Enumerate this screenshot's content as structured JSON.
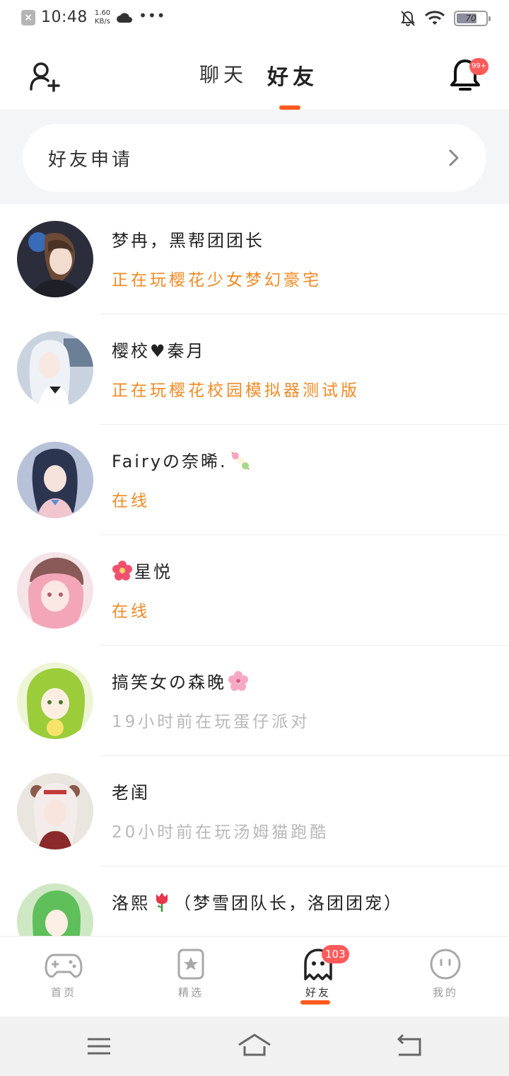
{
  "status_bar": {
    "time": "10:48",
    "speed_value": "1.60",
    "speed_unit": "KB/s",
    "more": "•••",
    "battery": "70"
  },
  "header": {
    "tabs": [
      {
        "label": "聊天",
        "active": false
      },
      {
        "label": "好友",
        "active": true
      }
    ],
    "notification_badge": "99+"
  },
  "friend_request": {
    "label": "好友申请"
  },
  "friends": [
    {
      "name": "梦冉，黑帮团团长",
      "name_emoji": "",
      "status": "正在玩樱花少女梦幻豪宅",
      "active": true
    },
    {
      "name": "樱校♥秦月",
      "name_emoji": "",
      "status": "正在玩樱花校园模拟器测试版",
      "active": true
    },
    {
      "name": "Fairyの奈晞.",
      "name_emoji": "dango-emoji",
      "status": "在线",
      "active": true
    },
    {
      "name": "星悦",
      "name_emoji_prefix": "hibiscus-emoji",
      "status": "在线",
      "active": true
    },
    {
      "name": "搞笑女の森晚",
      "name_emoji": "cherry-blossom-emoji",
      "status": "19小时前在玩蛋仔派对",
      "active": false
    },
    {
      "name": "老闺",
      "name_emoji": "",
      "status": "20小时前在玩汤姆猫跑酷",
      "active": false
    },
    {
      "name": "洛熙",
      "name_emoji": "tulip-emoji",
      "name_suffix": "（梦雪团队长，洛团团宠）",
      "status": "",
      "active": false
    }
  ],
  "bottom_nav": {
    "items": [
      {
        "label": "首页",
        "icon": "gamepad-icon",
        "active": false
      },
      {
        "label": "精选",
        "icon": "star-card-icon",
        "active": false
      },
      {
        "label": "好友",
        "icon": "ghost-icon",
        "active": true,
        "badge": "103"
      },
      {
        "label": "我的",
        "icon": "face-icon",
        "active": false
      }
    ]
  },
  "colors": {
    "accent": "#ff5a1f",
    "status_active": "#f08a24",
    "status_inactive": "#b8b8b8",
    "badge": "#ff5a5a"
  }
}
